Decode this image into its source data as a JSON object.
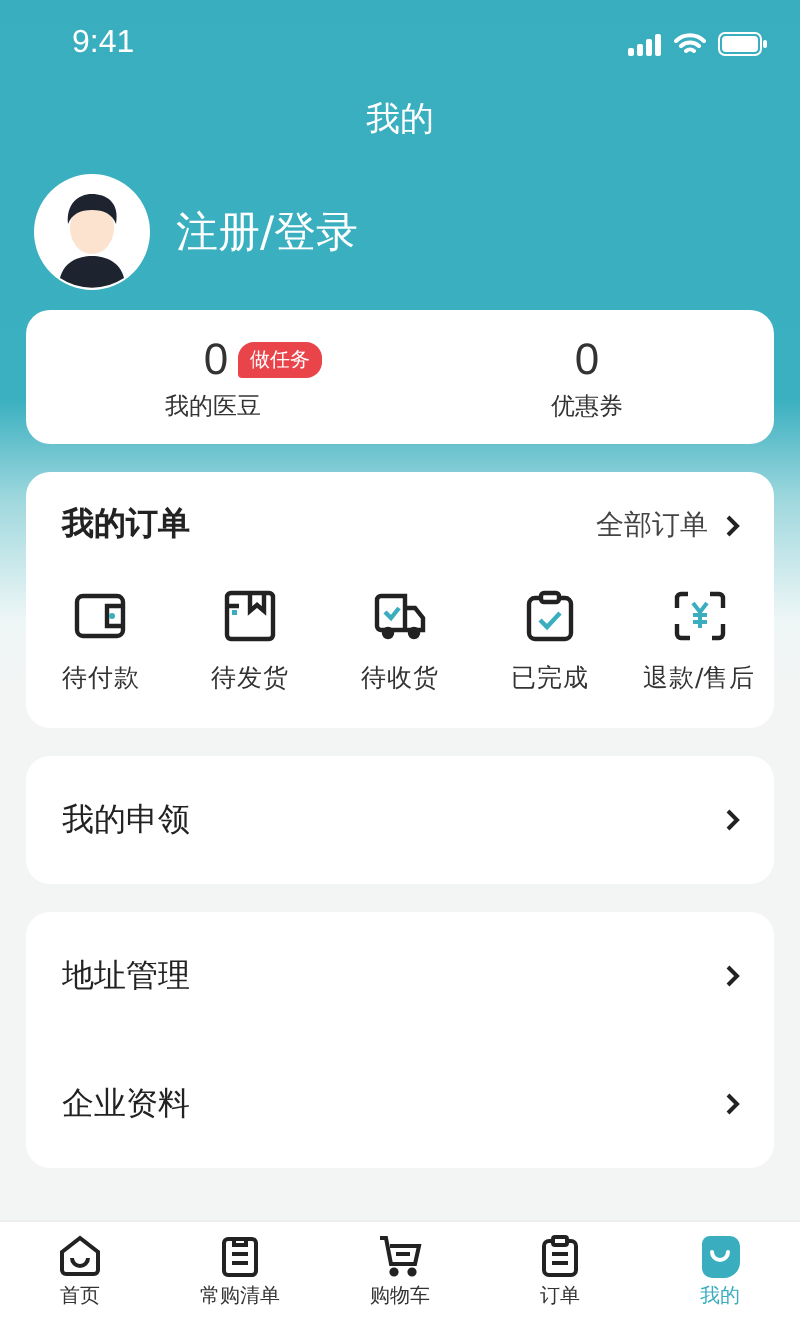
{
  "status_bar": {
    "time": "9:41"
  },
  "title": "我的",
  "profile": {
    "login_label": "注册/登录"
  },
  "stats": [
    {
      "value": "0",
      "label": "我的医豆",
      "badge": "做任务"
    },
    {
      "value": "0",
      "label": "优惠券"
    }
  ],
  "orders": {
    "title": "我的订单",
    "all_link": "全部订单",
    "items": [
      {
        "label": "待付款",
        "kind": "wallet"
      },
      {
        "label": "待发货",
        "kind": "box"
      },
      {
        "label": "待收货",
        "kind": "truck"
      },
      {
        "label": "已完成",
        "kind": "clipboard"
      },
      {
        "label": "退款/售后",
        "kind": "refund"
      }
    ]
  },
  "menu_groups": [
    {
      "items": [
        {
          "label": "我的申领"
        }
      ]
    },
    {
      "items": [
        {
          "label": "地址管理"
        },
        {
          "label": "企业资料"
        }
      ]
    }
  ],
  "tab_bar": [
    {
      "label": "首页",
      "kind": "home",
      "selected": false
    },
    {
      "label": "常购清单",
      "kind": "list",
      "selected": false
    },
    {
      "label": "购物车",
      "kind": "cart",
      "selected": false
    },
    {
      "label": "订单",
      "kind": "orders",
      "selected": false
    },
    {
      "label": "我的",
      "kind": "me",
      "selected": true
    }
  ]
}
